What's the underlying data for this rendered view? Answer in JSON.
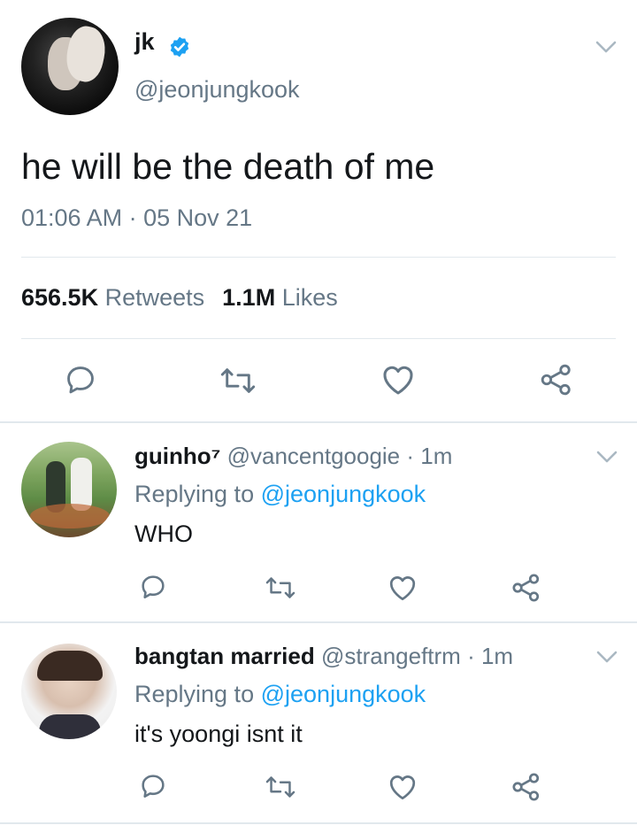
{
  "tweet": {
    "name": "jk",
    "handle": "@jeonjungkook",
    "text": "he will be the death of me",
    "timestamp": "01:06 AM · 05 Nov 21",
    "retweets_count": "656.5K",
    "retweets_label": "Retweets",
    "likes_count": "1.1M",
    "likes_label": "Likes",
    "verified": true
  },
  "replies": [
    {
      "name": "guinho⁷",
      "handle": "@vancentgoogie",
      "time": "· 1m",
      "replying_prefix": "Replying to",
      "replying_to": "@jeonjungkook",
      "text": "WHO"
    },
    {
      "name": "bangtan married",
      "handle": "@strangeftrm",
      "time": "· 1m",
      "replying_prefix": "Replying to",
      "replying_to": "@jeonjungkook",
      "text": "it's yoongi isnt it"
    }
  ],
  "icons": {
    "reply": "reply-icon",
    "retweet": "retweet-icon",
    "like": "heart-icon",
    "share": "share-icon",
    "more": "chevron-down-icon",
    "verified": "verified-badge-icon"
  },
  "colors": {
    "text": "#14171a",
    "secondary": "#657786",
    "link": "#1da1f2",
    "divider": "#e1e8ed",
    "icon": "#657786"
  }
}
